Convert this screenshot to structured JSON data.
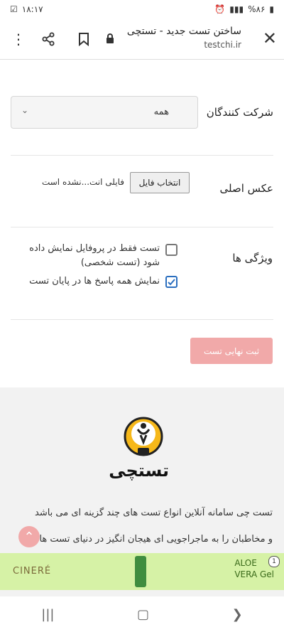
{
  "status_bar": {
    "time": "۱۸:۱۷",
    "battery": "%۸۶"
  },
  "browser": {
    "title": "ساختن تست جدید - تستچی",
    "url": "testchi.ir",
    "icons": [
      "close-icon",
      "lock-icon",
      "bookmark-icon",
      "share-icon",
      "more-vert-icon"
    ]
  },
  "form": {
    "participants": {
      "label": "شرکت کنندگان",
      "selected": "همه"
    },
    "main_image": {
      "label": "عکس اصلی",
      "button": "انتخاب فایل",
      "status": "فایلی انت...نشده است"
    },
    "features": {
      "label": "ویژگی ها",
      "options": [
        {
          "text": "تست فقط در پروفایل نمایش داده شود (تست شخصی)",
          "checked": false
        },
        {
          "text": "نمایش همه پاسخ ها در پایان تست",
          "checked": true
        }
      ]
    },
    "submit": "ثبت نهایی تست"
  },
  "footer": {
    "brand": "تستچی",
    "description_lines": [
      "تست چی سامانه آنلاین انواع تست های چند گزینه ای می باشد",
      "و مخاطبان را به ماجراجویی ای هیجان انگیز در دنیای تست ها"
    ]
  },
  "ad": {
    "left_brand": "CINERÉ",
    "right_brand_line1": "ALOE",
    "right_brand_line2": "VERA Gel",
    "badge": "1"
  },
  "colors": {
    "accent": "#f1a9a9",
    "ad_bg": "#d6f2a6"
  }
}
